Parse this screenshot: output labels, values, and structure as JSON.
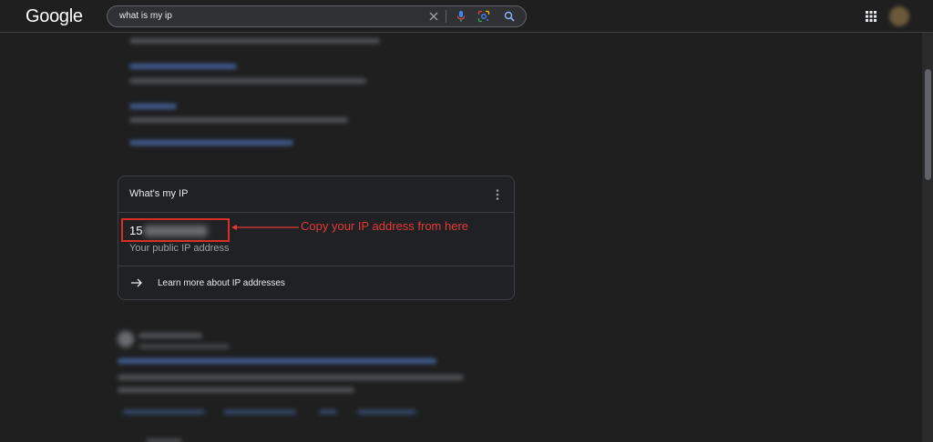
{
  "header": {
    "logo": "Google",
    "search_query": "what is my ip"
  },
  "card": {
    "title": "What's my IP",
    "ip_visible_prefix": "15",
    "ip_label": "Your public IP address",
    "learn_more": "Learn more about IP addresses"
  },
  "annotation": {
    "text": "Copy your IP address from here",
    "color": "#e53935"
  },
  "colors": {
    "background": "#1f1f1f",
    "card_background": "#202124",
    "highlight_border": "#d93025"
  }
}
